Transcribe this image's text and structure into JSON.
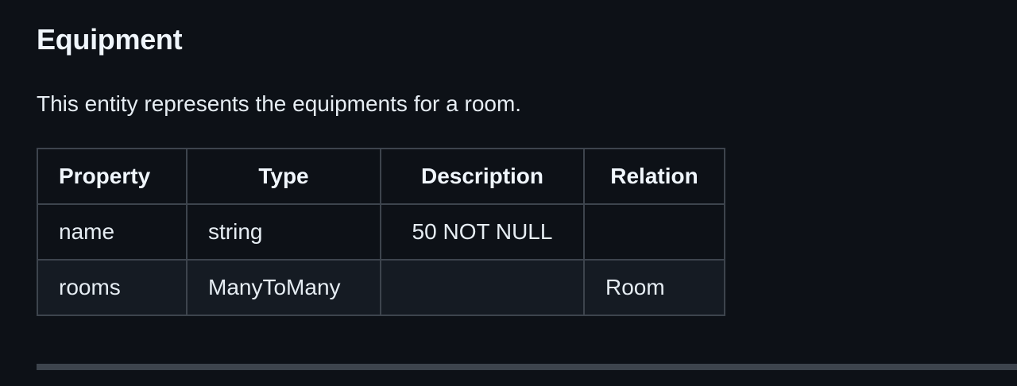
{
  "section": {
    "title": "Equipment",
    "intro": "This entity represents the equipments for a room."
  },
  "table": {
    "headers": [
      "Property",
      "Type",
      "Description",
      "Relation"
    ],
    "rows": [
      [
        "name",
        "string",
        "50 NOT NULL",
        ""
      ],
      [
        "rooms",
        "ManyToMany",
        "",
        "Room"
      ]
    ]
  }
}
